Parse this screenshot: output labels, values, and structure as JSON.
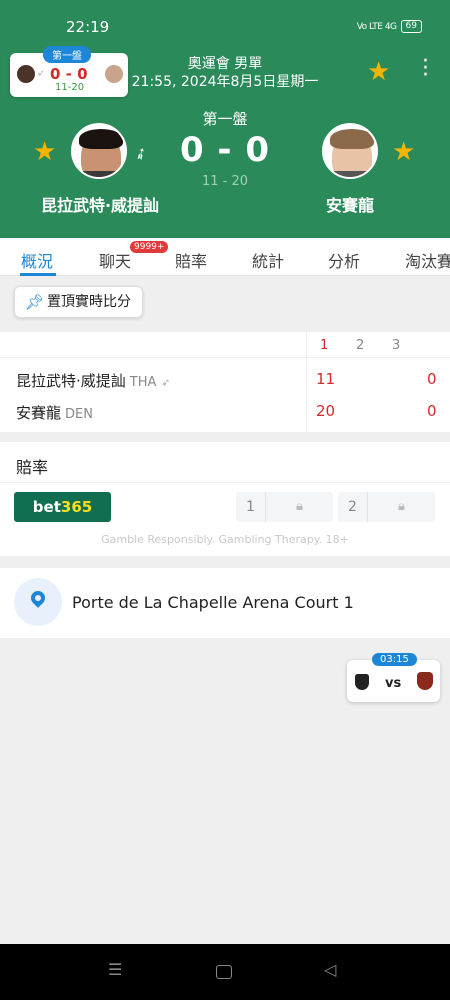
{
  "status": {
    "time": "22:19",
    "battery": "69",
    "signal": "Vo LTE 4G"
  },
  "mini": {
    "tag": "第一盤",
    "score": "0 - 0",
    "sub": "11-20"
  },
  "match": {
    "title": "奧運會 男單",
    "time": "21:55, 2024年8月5日星期一",
    "set_label": "第一盤",
    "score": "0 - 0",
    "set_scores": "11 - 20"
  },
  "players": {
    "home": {
      "name": "昆拉武特·威提訕",
      "country": "THA",
      "set1": "11",
      "sets_won": "0"
    },
    "away": {
      "name": "安賽龍",
      "country": "DEN",
      "set1": "20",
      "sets_won": "0"
    }
  },
  "tabs": [
    "概況",
    "聊天",
    "賠率",
    "統計",
    "分析",
    "淘汰賽"
  ],
  "chat_badge": "9999+",
  "pin_button": "置頂實時比分",
  "table_headers": [
    "1",
    "2",
    "3"
  ],
  "odds": {
    "title": "賠率",
    "brand_a": "bet",
    "brand_b": "365",
    "opt1": "1",
    "opt2": "2",
    "disclaimer": "Gamble Responsibly. Gambling Therapy. 18+"
  },
  "venue": "Porte de La Chapelle Arena Court 1",
  "widget": {
    "time": "03:15",
    "vs": "vs"
  },
  "icons": {
    "star": "★",
    "shuttlecock": "🏸",
    "lock": "🔒",
    "pin": "📌",
    "menu": "⋮"
  },
  "colors": {
    "header_green": "#2a8a5a",
    "accent_blue": "#1e86d6",
    "score_red": "#d62a2a",
    "star": "#f5b400"
  }
}
